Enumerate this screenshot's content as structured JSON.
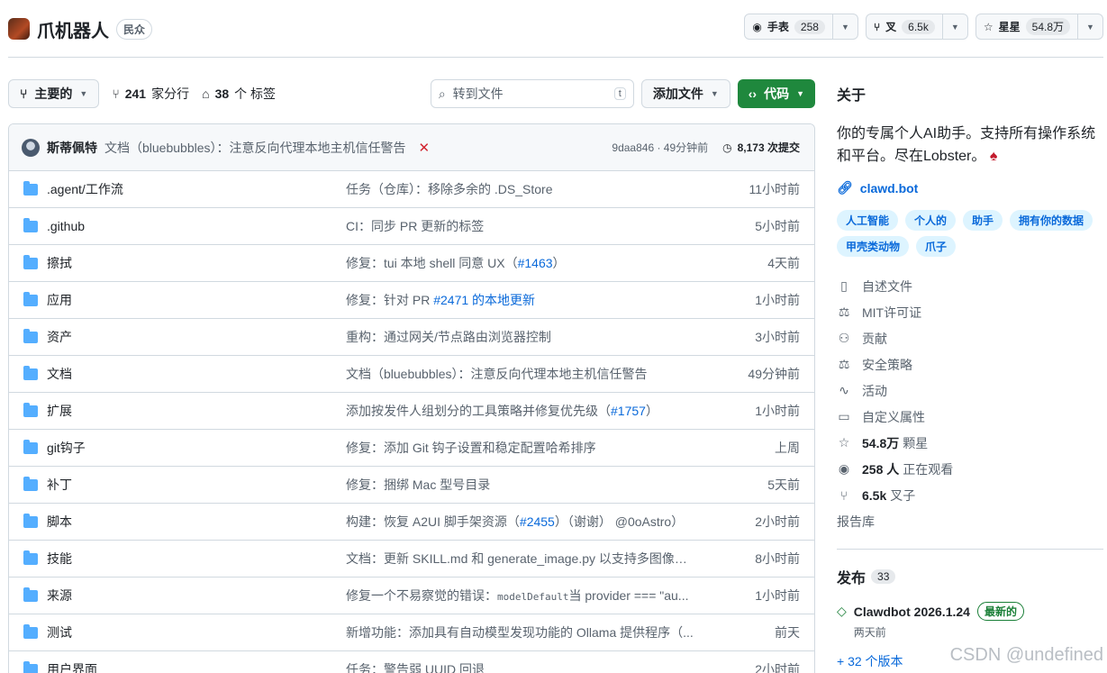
{
  "repo": {
    "name": "爪机器人",
    "visibility": "民众"
  },
  "header_buttons": {
    "watch": {
      "label": "手表",
      "count": "258"
    },
    "fork": {
      "label": "叉",
      "count": "6.5k"
    },
    "star": {
      "label": "星星",
      "count": "54.8万"
    }
  },
  "toolbar": {
    "branch": "主要的",
    "branches_count": "241",
    "branches_label": "家分行",
    "tags_count": "38",
    "tags_label": "个 标签",
    "search_placeholder": "转到文件",
    "search_kbd": "t",
    "add_file": "添加文件",
    "code": "代码"
  },
  "latest_commit": {
    "author": "斯蒂佩特",
    "message": "文档（bluebubbles）：注意反向代理本地主机信任警告",
    "status": "✕",
    "meta": "9daa846 · 49分钟前",
    "count": "8,173 次提交"
  },
  "files": [
    {
      "name": ".agent/工作流",
      "msg": "任务（仓库）：移除多余的 .DS_Store",
      "time": "11小时前"
    },
    {
      "name": ".github",
      "msg": "CI：同步 PR 更新的标签",
      "time": "5小时前"
    },
    {
      "name": "擦拭",
      "msg_pre": "修复：tui 本地 shell 同意 UX（",
      "msg_link": "#1463",
      "msg_post": "）",
      "time": "4天前"
    },
    {
      "name": "应用",
      "msg_pre": "修复：针对 PR ",
      "msg_link": "#2471 的本地更新",
      "msg_post": "",
      "time": "1小时前"
    },
    {
      "name": "资产",
      "msg": "重构：通过网关/节点路由浏览器控制",
      "time": "3小时前"
    },
    {
      "name": "文档",
      "msg": "文档（bluebubbles）：注意反向代理本地主机信任警告",
      "time": "49分钟前"
    },
    {
      "name": "扩展",
      "msg_pre": "添加按发件人组划分的工具策略并修复优先级（",
      "msg_link": "#1757",
      "msg_post": "）",
      "time": "1小时前"
    },
    {
      "name": "git钩子",
      "msg": "修复：添加 Git 钩子设置和稳定配置哈希排序",
      "time": "上周"
    },
    {
      "name": "补丁",
      "msg": "修复：捆绑 Mac 型号目录",
      "time": "5天前"
    },
    {
      "name": "脚本",
      "msg_pre": "构建：恢复 A2UI 脚手架资源（",
      "msg_link": "#2455",
      "msg_post": "）（谢谢） @0oAstro）",
      "time": "2小时前"
    },
    {
      "name": "技能",
      "msg": "文档：更新 SKILL.md 和 generate_image.py 以支持多图像编...",
      "time": "8小时前"
    },
    {
      "name": "来源",
      "msg_pre": "修复一个不易察觉的错误：",
      "msg_code": "modelDefault",
      "msg_post": "当 provider === \"au...",
      "time": "1小时前"
    },
    {
      "name": "测试",
      "msg": "新增功能：添加具有自动模型发现功能的 Ollama 提供程序（...",
      "time": "前天"
    },
    {
      "name": "用户界面",
      "msg": "任务：警告弱 UUID 回退",
      "time": "2小时前"
    }
  ],
  "about": {
    "title": "关于",
    "description": "你的专属个人AI助手。支持所有操作系统和平台。尽在Lobster。",
    "website": "clawd.bot",
    "topics": [
      "人工智能",
      "个人的",
      "助手",
      "拥有你的数据",
      "甲壳类动物",
      "爪子"
    ],
    "readme": "自述文件",
    "license": "MIT许可证",
    "contributing": "贡献",
    "security": "安全策略",
    "activity": "活动",
    "custom_props": "自定义属性",
    "stars_count": "54.8万",
    "stars_label": "颗星",
    "watchers_count": "258 人",
    "watchers_label": "正在观看",
    "forks_count": "6.5k",
    "forks_label": "叉子",
    "report": "报告库"
  },
  "releases": {
    "title": "发布",
    "count": "33",
    "latest_name": "Clawdbot 2026.1.24",
    "latest_badge": "最新的",
    "latest_date": "两天前",
    "more": "+ 32 个版本"
  },
  "watermark": "CSDN @undefined"
}
